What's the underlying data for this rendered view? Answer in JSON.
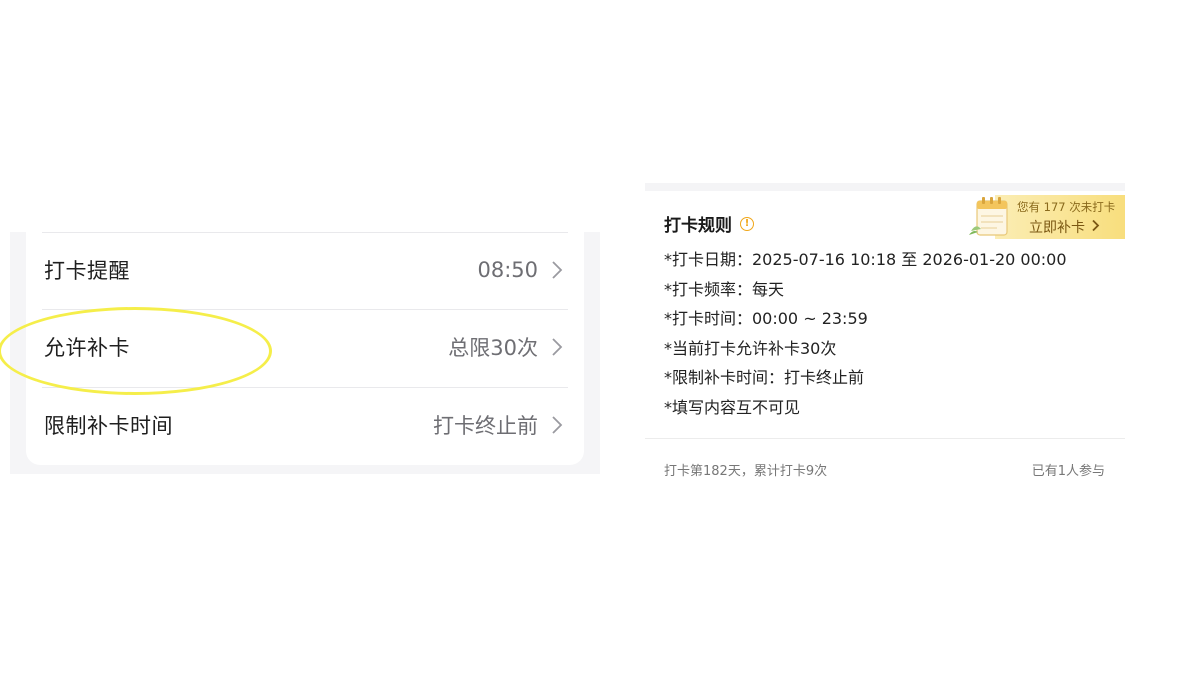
{
  "settings": {
    "rows": [
      {
        "label": "打卡提醒",
        "value": "08:50"
      },
      {
        "label": "允许补卡",
        "value": "总限30次"
      },
      {
        "label": "限制补卡时间",
        "value": "打卡终止前"
      }
    ],
    "highlight_color": "#f5ee4a"
  },
  "rules_card": {
    "title": "打卡规则",
    "info_icon": "info-circle-icon",
    "banner": {
      "line1": "您有 177 次未打卡",
      "action": "立即补卡",
      "illustration": "calendar-icon",
      "color": "#f8de7d"
    },
    "rules": [
      "*打卡日期：2025-07-16 10:18 至 2026-01-20 00:00",
      "*打卡频率：每天",
      "*打卡时间：00:00 ~ 23:59",
      "*当前打卡允许补卡30次",
      "*限制补卡时间：打卡终止前",
      "*填写内容互不可见"
    ],
    "stats": "打卡第182天，累计打卡9次",
    "participants": "已有1人参与"
  }
}
